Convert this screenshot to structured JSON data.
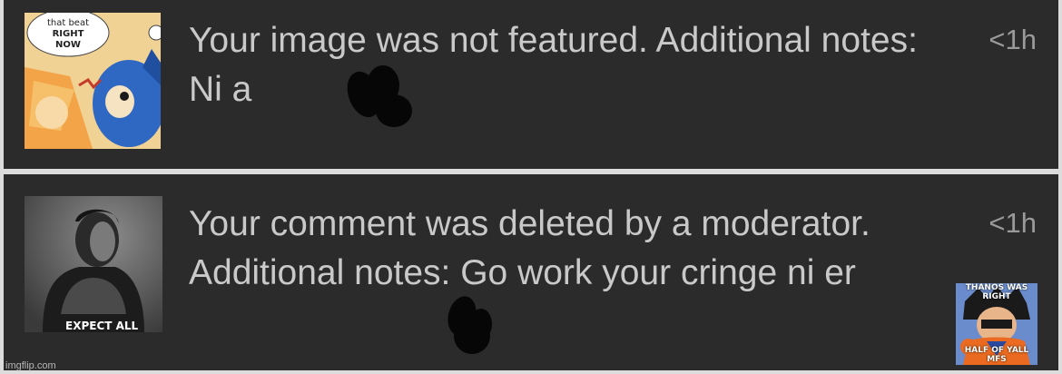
{
  "notifications": [
    {
      "message": "Your image was not featured. Additional notes: Ni a",
      "time": "<1h",
      "thumb_text_lines": [
        "that beat",
        "RIGHT",
        "NOW"
      ]
    },
    {
      "message": "Your comment was deleted by a moderator. Additional notes: Go work your cringe ni er",
      "time": "<1h",
      "thumb_caption": "EXPECT ALL"
    }
  ],
  "overlay_image": {
    "top_text": "THANOS WAS RIGHT",
    "bottom_text": "HALF OF YALL MFS"
  },
  "watermark": "imgflip.com",
  "colors": {
    "panel_bg": "#2b2b2b",
    "divider": "#dcdcdc",
    "message_text": "#c9c9c9",
    "time_text": "#9a9a9a"
  }
}
